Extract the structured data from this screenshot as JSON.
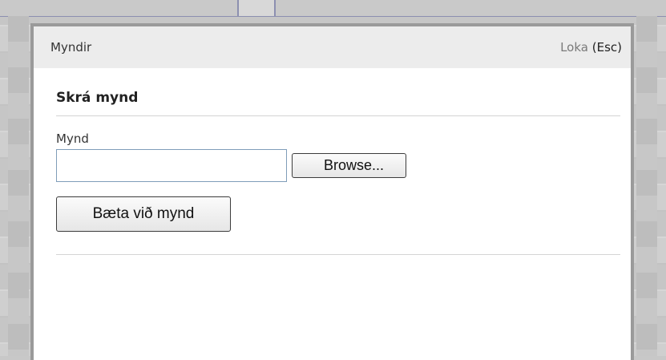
{
  "dialog": {
    "title": "Myndir",
    "close_label": "Loka",
    "close_shortcut": "(Esc)"
  },
  "form": {
    "heading": "Skrá mynd",
    "file_label": "Mynd",
    "file_value": "",
    "browse_label": "Browse...",
    "submit_label": "Bæta við mynd"
  }
}
